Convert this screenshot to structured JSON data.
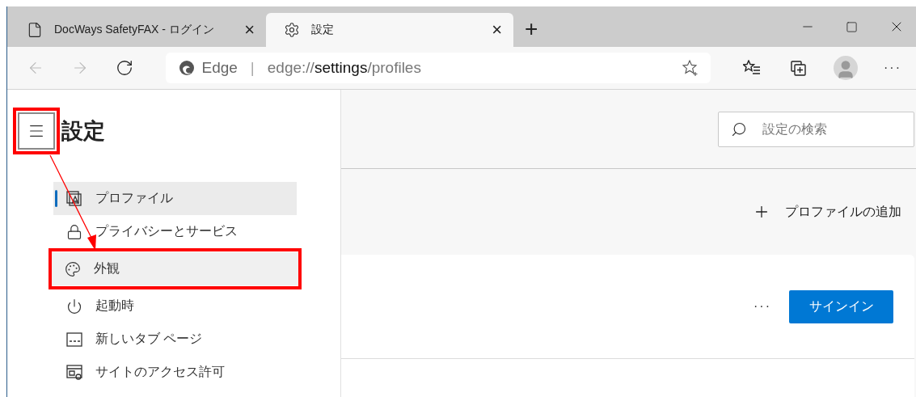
{
  "tabs": [
    {
      "title": "DocWays SafetyFAX - ログイン",
      "close": "×",
      "selected": false
    },
    {
      "title": "設定",
      "close": "×",
      "selected": true
    }
  ],
  "new_tab": "+",
  "address_bar": {
    "site_label": "Edge",
    "separator": "|",
    "url": [
      {
        "text": "edge://",
        "emphasis": false
      },
      {
        "text": "settings",
        "emphasis": true
      },
      {
        "text": "/profiles",
        "emphasis": false
      }
    ]
  },
  "toolbar": {
    "more": "···"
  },
  "sidebar": {
    "menu_button": {
      "annotated": true
    },
    "title": "設定",
    "items": [
      {
        "label": "プロファイル",
        "selected": true,
        "hovered": false,
        "annotated": false
      },
      {
        "label": "プライバシーとサービス",
        "selected": false,
        "hovered": false,
        "annotated": false
      },
      {
        "label": "外観",
        "selected": false,
        "hovered": true,
        "annotated": true
      },
      {
        "label": "起動時",
        "selected": false,
        "hovered": false,
        "annotated": false
      },
      {
        "label": "新しいタブ ページ",
        "selected": false,
        "hovered": false,
        "annotated": false
      },
      {
        "label": "サイトのアクセス許可",
        "selected": false,
        "hovered": false,
        "annotated": false
      }
    ]
  },
  "search": {
    "placeholder": "設定の検索"
  },
  "add_profile": "プロファイルの追加",
  "profile_card": {
    "more": "···",
    "sign_in": "サインイン"
  }
}
